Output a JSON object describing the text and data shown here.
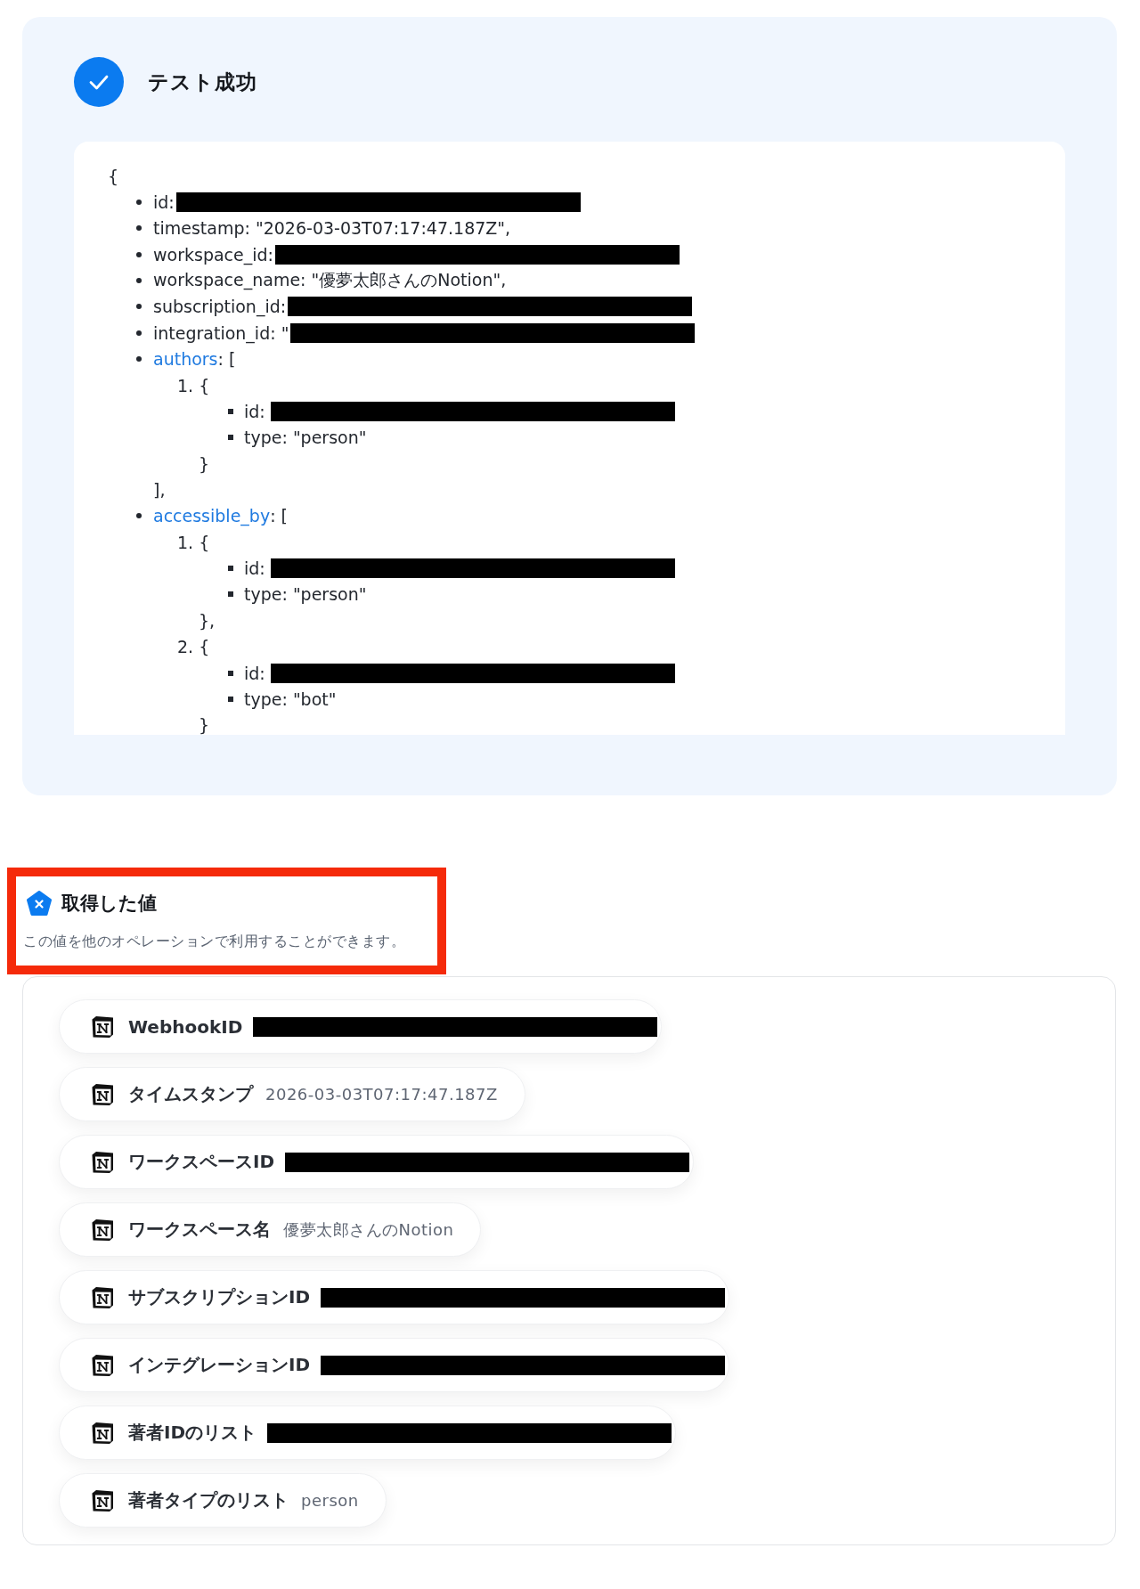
{
  "test_result": {
    "title": "テスト成功",
    "payload": {
      "open": "{",
      "entries": [
        {
          "kind": "field",
          "text": "id:",
          "redacted": true
        },
        {
          "kind": "field",
          "text": "timestamp: \"2026-03-03T07:17:47.187Z\",",
          "redacted": false
        },
        {
          "kind": "field",
          "text": "workspace_id:",
          "redacted": true
        },
        {
          "kind": "field",
          "text": "workspace_name: \"優夢太郎さんのNotion\",",
          "redacted": false
        },
        {
          "kind": "field",
          "text": "subscription_id:",
          "redacted": true
        },
        {
          "kind": "field",
          "text": "integration_id: \"",
          "redacted": true
        },
        {
          "kind": "array",
          "key": "authors",
          "open": ": [",
          "items": [
            {
              "number": "1.",
              "open": "{",
              "fields": [
                {
                  "text": "id:",
                  "redacted": true
                },
                {
                  "text": "type: \"person\"",
                  "redacted": false
                }
              ],
              "close": "}"
            }
          ],
          "close": "],"
        },
        {
          "kind": "array",
          "key": "accessible_by",
          "open": ": [",
          "items": [
            {
              "number": "1.",
              "open": "{",
              "fields": [
                {
                  "text": "id:",
                  "redacted": true
                },
                {
                  "text": "type: \"person\"",
                  "redacted": false
                }
              ],
              "close": "},"
            },
            {
              "number": "2.",
              "open": "{",
              "fields": [
                {
                  "text": "id:",
                  "redacted": true
                },
                {
                  "text": "type: \"bot\"",
                  "redacted": false
                }
              ],
              "close": "}"
            }
          ]
        }
      ]
    }
  },
  "output_values": {
    "highlighted": true,
    "title": "取得した値",
    "description": "この値を他のオペレーションで利用することができます。",
    "items": [
      {
        "label": "WebhookID",
        "redacted": true
      },
      {
        "label": "タイムスタンプ",
        "value": "2026-03-03T07:17:47.187Z",
        "redacted": false
      },
      {
        "label": "ワークスペースID",
        "redacted": true
      },
      {
        "label": "ワークスペース名",
        "value": "優夢太郎さんのNotion",
        "redacted": false
      },
      {
        "label": "サブスクリプションID",
        "redacted": true
      },
      {
        "label": "インテグレーションID",
        "redacted": true
      },
      {
        "label": "著者IDのリスト",
        "redacted": true
      },
      {
        "label": "著者タイプのリスト",
        "value": "person",
        "redacted": false
      }
    ]
  }
}
